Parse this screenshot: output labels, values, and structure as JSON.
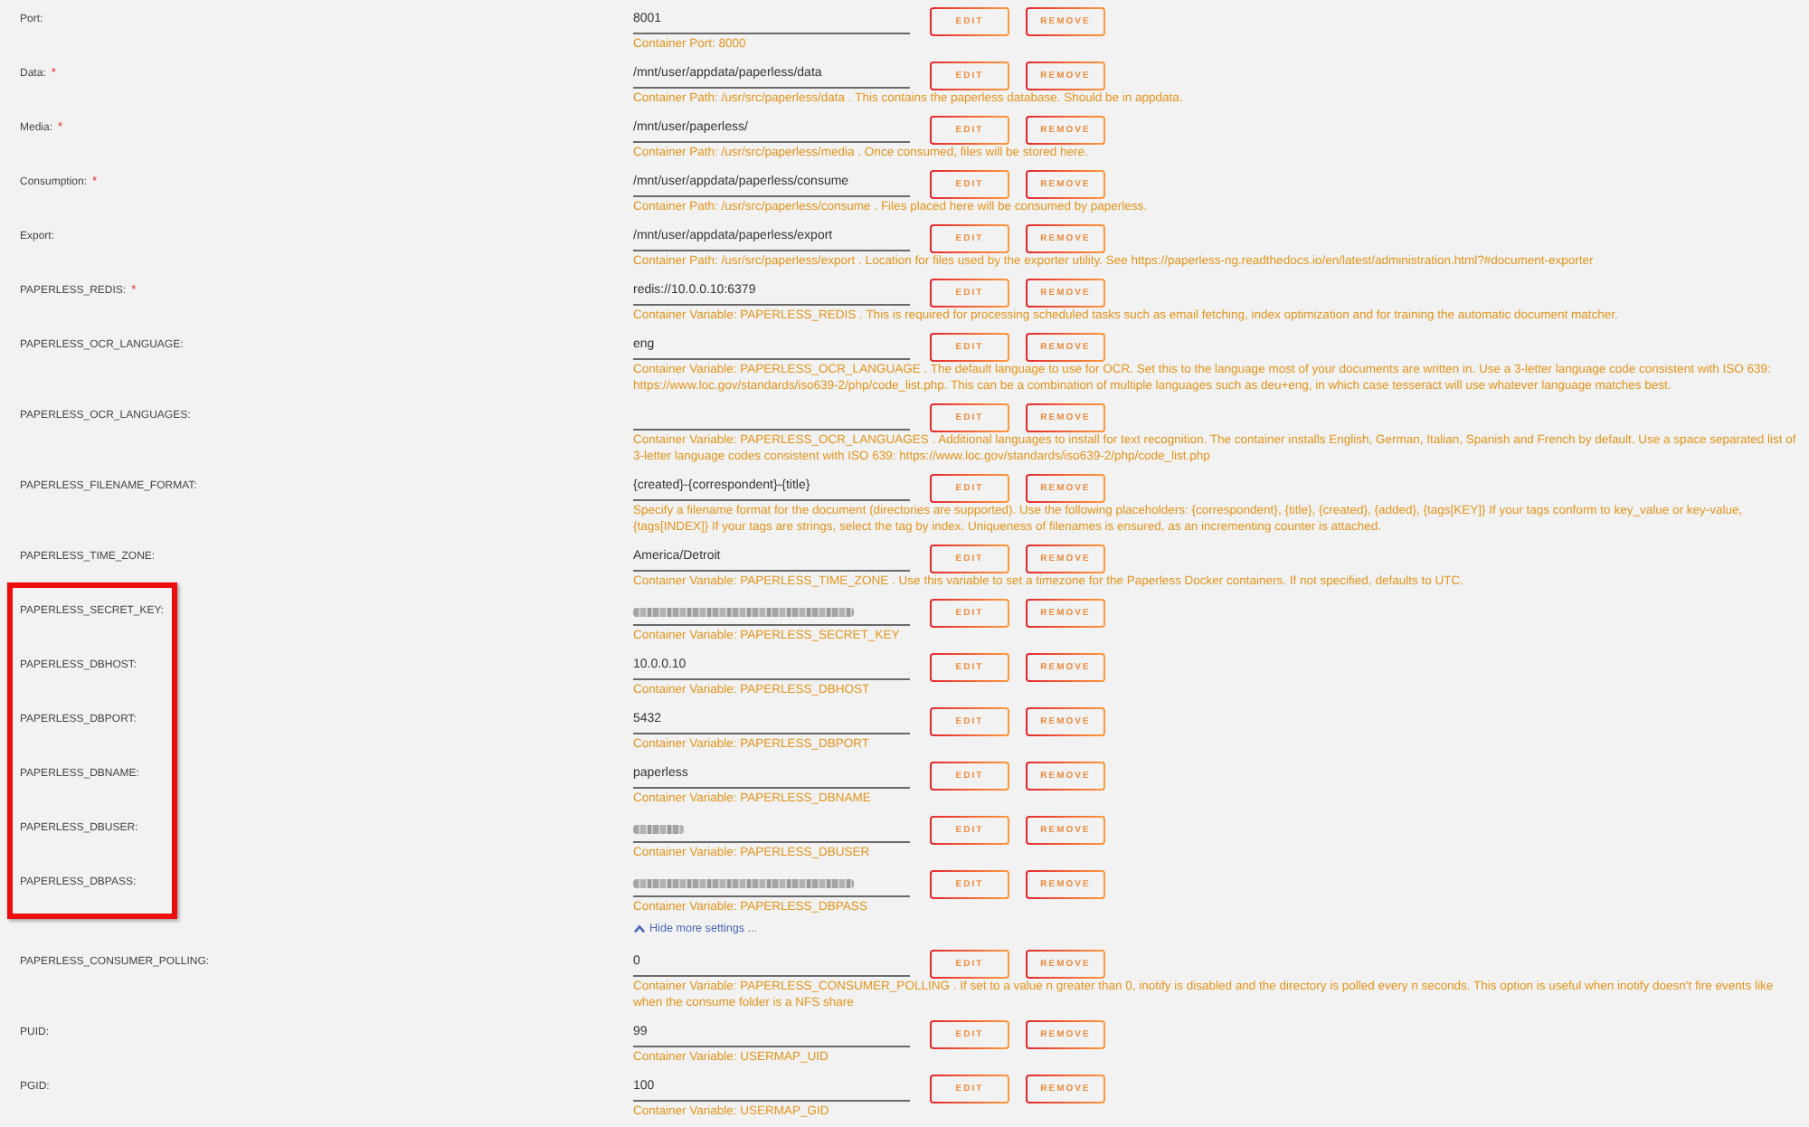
{
  "fields": [
    {
      "label": "Port:",
      "value": "8001",
      "kind": "plain",
      "buttons": [
        "EDIT",
        "REMOVE"
      ],
      "description": "Container Port: 8000",
      "highlighted": false
    },
    {
      "label": "Data:",
      "required_mark": "*",
      "value": "/mnt/user/appdata/paperless/data",
      "kind": "plain",
      "buttons": [
        "EDIT",
        "REMOVE"
      ],
      "description": "Container Path: /usr/src/paperless/data . This contains the paperless database. Should be in appdata.",
      "highlighted": false
    },
    {
      "label": "Media:",
      "required_mark": "*",
      "value": "/mnt/user/paperless/",
      "kind": "plain",
      "buttons": [
        "EDIT",
        "REMOVE"
      ],
      "description": "Container Path: /usr/src/paperless/media . Once consumed, files will be stored here.",
      "highlighted": false
    },
    {
      "label": "Consumption:",
      "required_mark": "*",
      "value": "/mnt/user/appdata/paperless/consume",
      "kind": "plain",
      "buttons": [
        "EDIT",
        "REMOVE"
      ],
      "description": "Container Path: /usr/src/paperless/consume . Files placed here will be consumed by paperless.",
      "highlighted": false
    },
    {
      "label": "Export:",
      "value": "/mnt/user/appdata/paperless/export",
      "kind": "plain",
      "buttons": [
        "EDIT",
        "REMOVE"
      ],
      "description": "Container Path: /usr/src/paperless/export . Location for files used by the exporter utility. See https://paperless-ng.readthedocs.io/en/latest/administration.html?#document-exporter",
      "highlighted": false
    },
    {
      "label": "PAPERLESS_REDIS:",
      "required_mark": "*",
      "value": "redis://10.0.0.10:6379",
      "kind": "plain",
      "buttons": [
        "EDIT",
        "REMOVE"
      ],
      "description": "Container Variable: PAPERLESS_REDIS . This is required for processing scheduled tasks such as email fetching, index optimization and for training the automatic document matcher.",
      "highlighted": false
    },
    {
      "label": "PAPERLESS_OCR_LANGUAGE:",
      "value": "eng",
      "kind": "plain",
      "buttons": [
        "EDIT",
        "REMOVE"
      ],
      "description": "Container Variable: PAPERLESS_OCR_LANGUAGE . The default language to use for OCR. Set this to the language most of your documents are written in. Use a 3-letter language code consistent with ISO 639: https://www.loc.gov/standards/iso639-2/php/code_list.php. This can be a combination of multiple languages such as deu+eng, in which case tesseract will use whatever language matches best.",
      "highlighted": false
    },
    {
      "label": "PAPERLESS_OCR_LANGUAGES:",
      "kind": "plain",
      "buttons": [
        "EDIT",
        "REMOVE"
      ],
      "description": "Container Variable: PAPERLESS_OCR_LANGUAGES . Additional languages to install for text recognition. The container installs English, German, Italian, Spanish and French by default. Use a space separated list of 3-letter language codes consistent with ISO 639: https://www.loc.gov/standards/iso639-2/php/code_list.php",
      "highlighted": false
    },
    {
      "label": "PAPERLESS_FILENAME_FORMAT:",
      "value": "{created}-{correspondent}-{title}",
      "kind": "plain",
      "buttons": [
        "EDIT",
        "REMOVE"
      ],
      "description": "Specify a filename format for the document (directories are supported). Use the following placeholders: {correspondent}, {title}, {created}, {added}, {tags[KEY]} If your tags conform to key_value or key-value, {tags[INDEX]} If your tags are strings, select the tag by index. Uniqueness of filenames is ensured, as an incrementing counter is attached.",
      "highlighted": false
    },
    {
      "label": "PAPERLESS_TIME_ZONE:",
      "value": "America/Detroit",
      "kind": "plain",
      "buttons": [
        "EDIT",
        "REMOVE"
      ],
      "description": "Container Variable: PAPERLESS_TIME_ZONE . Use this variable to set a timezone for the Paperless Docker containers. If not specified, defaults to UTC.",
      "highlighted": false
    },
    {
      "label": "PAPERLESS_SECRET_KEY:",
      "kind": "blurred",
      "buttons": [
        "EDIT",
        "REMOVE"
      ],
      "description": "Container Variable: PAPERLESS_SECRET_KEY",
      "highlighted": true
    },
    {
      "label": "PAPERLESS_DBHOST:",
      "value": "10.0.0.10",
      "kind": "plain",
      "buttons": [
        "EDIT",
        "REMOVE"
      ],
      "description": "Container Variable: PAPERLESS_DBHOST",
      "highlighted": true
    },
    {
      "label": "PAPERLESS_DBPORT:",
      "value": "5432",
      "kind": "plain",
      "buttons": [
        "EDIT",
        "REMOVE"
      ],
      "description": "Container Variable: PAPERLESS_DBPORT",
      "highlighted": true
    },
    {
      "label": "PAPERLESS_DBNAME:",
      "value": "paperless",
      "kind": "plain",
      "buttons": [
        "EDIT",
        "REMOVE"
      ],
      "description": "Container Variable: PAPERLESS_DBNAME",
      "highlighted": true
    },
    {
      "label": "PAPERLESS_DBUSER:",
      "kind": "blurred_short",
      "buttons": [
        "EDIT",
        "REMOVE"
      ],
      "description": "Container Variable: PAPERLESS_DBUSER",
      "highlighted": true
    },
    {
      "label": "PAPERLESS_DBPASS:",
      "kind": "blurred",
      "buttons": [
        "EDIT",
        "REMOVE"
      ],
      "description": "Container Variable: PAPERLESS_DBPASS",
      "highlighted": true
    }
  ],
  "more_settings_toggle": {
    "label": "Hide more settings ...",
    "expanded": true
  },
  "more_fields": [
    {
      "label": "PAPERLESS_CONSUMER_POLLING:",
      "value": "0",
      "kind": "plain",
      "buttons": [
        "EDIT",
        "REMOVE"
      ],
      "description": "Container Variable: PAPERLESS_CONSUMER_POLLING . If set to a value n greater than 0, inotify is disabled and the directory is polled every n seconds. This option is useful when inotify doesn't fire events like when the consume folder is a NFS share",
      "highlighted": false
    },
    {
      "label": "PUID:",
      "value": "99",
      "kind": "plain",
      "buttons": [
        "EDIT",
        "REMOVE"
      ],
      "description": "Container Variable: USERMAP_UID",
      "highlighted": false
    },
    {
      "label": "PGID:",
      "value": "100",
      "kind": "plain",
      "buttons": [
        "EDIT",
        "REMOVE"
      ],
      "description": "Container Variable: USERMAP_GID",
      "highlighted": false
    }
  ]
}
